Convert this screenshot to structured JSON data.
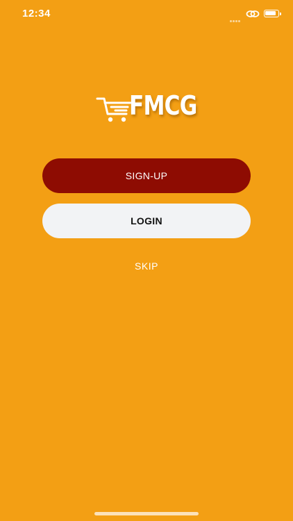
{
  "status_bar": {
    "time": "12:34"
  },
  "logo": {
    "text": "FMCG",
    "icon": "shopping-cart-icon"
  },
  "actions": {
    "signup_label": "SIGN-UP",
    "login_label": "LOGIN",
    "skip_label": "SKIP"
  },
  "colors": {
    "background": "#F39F14",
    "signup_button": "#8E0C02",
    "login_button": "#F2F3F5",
    "text_light": "#FFFFFF",
    "text_dark": "#111111"
  },
  "icons": {
    "signal": "signal-icon",
    "hotspot": "hotspot-icon",
    "battery": "battery-icon"
  }
}
